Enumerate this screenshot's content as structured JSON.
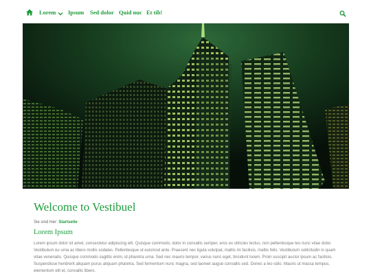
{
  "nav": {
    "home_icon": "home-icon",
    "items": [
      {
        "label": "Lorem",
        "has_dropdown": true
      },
      {
        "label": "Ipsum"
      },
      {
        "label": "Sed dolor"
      },
      {
        "label": "Quid nuc"
      },
      {
        "label": "Et tib!"
      }
    ],
    "search_icon": "search-icon"
  },
  "hero": {
    "image": "night-skyscrapers-green"
  },
  "main": {
    "title": "Welcome to Vestibuel",
    "breadcrumb": {
      "prefix": "Sie sind hier:",
      "current": "Startseite"
    },
    "section_title": "Lorem Ipsum",
    "body": "Lorem ipsum dolor sit amet, consectetur adipiscing elit. Quisque commodo, dolor in convallis semper, eros ex ultricies lectus, non pellentesque leo nunc vitae dolor. Vestibulum eu urna ac libero mollis sodales. Pellentesque ut euismod ante. Praesent nec ligula volutpat, mattis mi facilisis, mattis felis. Vestibulum sollicitudin in quam vitae venenatis. Quisque commodo sagittis enim, id pharetra urna. Sed nec mauris tempor, varius nunc eget, tincidunt lorem. Proin suscipit auctor ipsum ac facilisis. Suspendisse hendrerit aliquam purus aliquam pharetra. Sed fermentum nunc magna, sed laoreet augue convallis sed. Donec a leo odio. Mauris ut massa tempus, elementum elit et, convallis libero."
  },
  "colors": {
    "accent": "#1e9c3c",
    "text": "#7a7a7a",
    "background": "#ffffff"
  }
}
